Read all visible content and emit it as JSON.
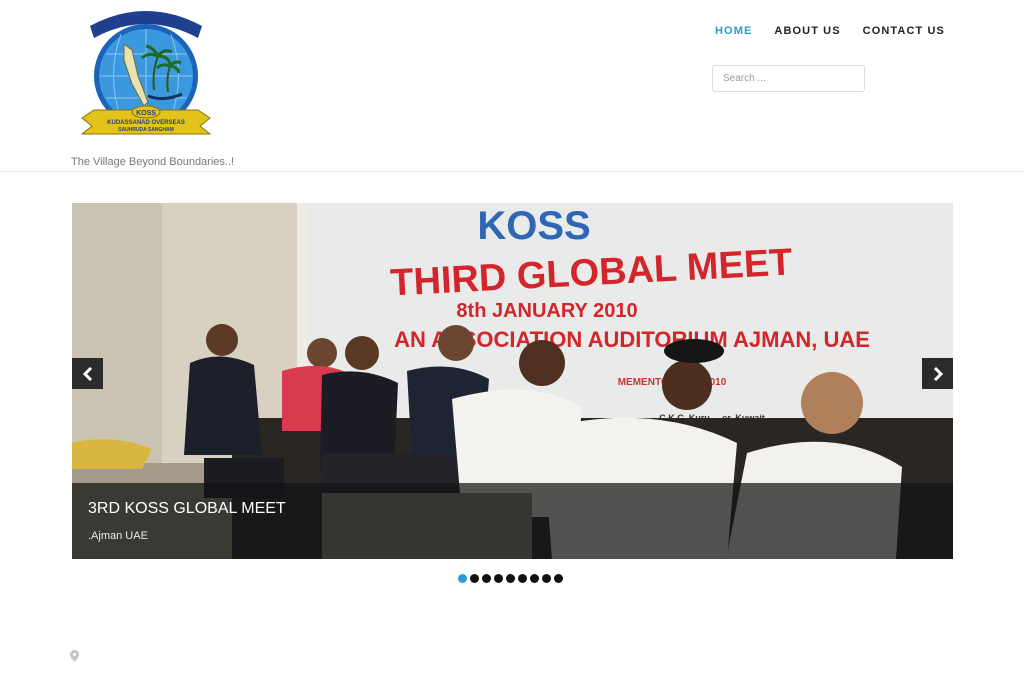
{
  "branding": {
    "logo_name": "KOSS",
    "logo_line1": "KUDASSANAD OVERSEAS",
    "logo_line2": "SAUHRUDA SANGHAM",
    "tagline": "The Village Beyond Boundaries..!"
  },
  "nav": {
    "items": [
      {
        "label": "HOME",
        "active": true
      },
      {
        "label": "ABOUT US",
        "active": false
      },
      {
        "label": "CONTACT US",
        "active": false
      }
    ]
  },
  "search": {
    "placeholder": "Search ..."
  },
  "slider": {
    "banner": {
      "brand": "KOSS",
      "headline": "THIRD GLOBAL MEET",
      "date": "8th JANUARY 2010",
      "venue": "AN ASSOCIATION AUDITORIUM AJMAN, UAE",
      "small_note": "MEMENTOS OF A 2010",
      "small_note2": "C.K.C. Kuru ... er, Kuwait"
    },
    "caption_title": "3RD KOSS GLOBAL MEET",
    "caption_subtitle": ".Ajman UAE",
    "slide_count": 9,
    "active_slide": 1
  },
  "colors": {
    "accent": "#2a9ad6",
    "banner_red": "#d2262b",
    "banner_blue": "#2f67b5"
  },
  "icons": {
    "prev": "chevron-left-icon",
    "next": "chevron-right-icon",
    "location": "map-pin-icon"
  }
}
